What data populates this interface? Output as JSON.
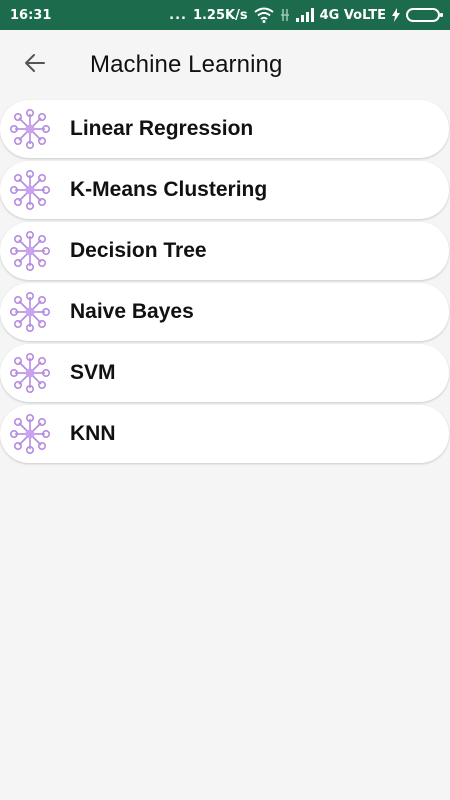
{
  "status_bar": {
    "time": "16:31",
    "dots": "...",
    "speed": "1.25K/s",
    "network": "4G VoLTE",
    "icons": [
      "wifi-icon",
      "signal-muted-icon",
      "cell-signal-icon",
      "charging-icon",
      "battery-icon"
    ],
    "background": "#1c6b4d"
  },
  "header": {
    "back_icon": "arrow-left-icon",
    "title": "Machine Learning"
  },
  "list": {
    "items": [
      {
        "label": "Linear Regression",
        "icon": "network-node-icon"
      },
      {
        "label": "K-Means Clustering",
        "icon": "network-node-icon"
      },
      {
        "label": "Decision Tree",
        "icon": "network-node-icon"
      },
      {
        "label": "Naive Bayes",
        "icon": "network-node-icon"
      },
      {
        "label": "SVM",
        "icon": "network-node-icon"
      },
      {
        "label": "KNN",
        "icon": "network-node-icon"
      }
    ],
    "icon_color": "#b58be0"
  }
}
